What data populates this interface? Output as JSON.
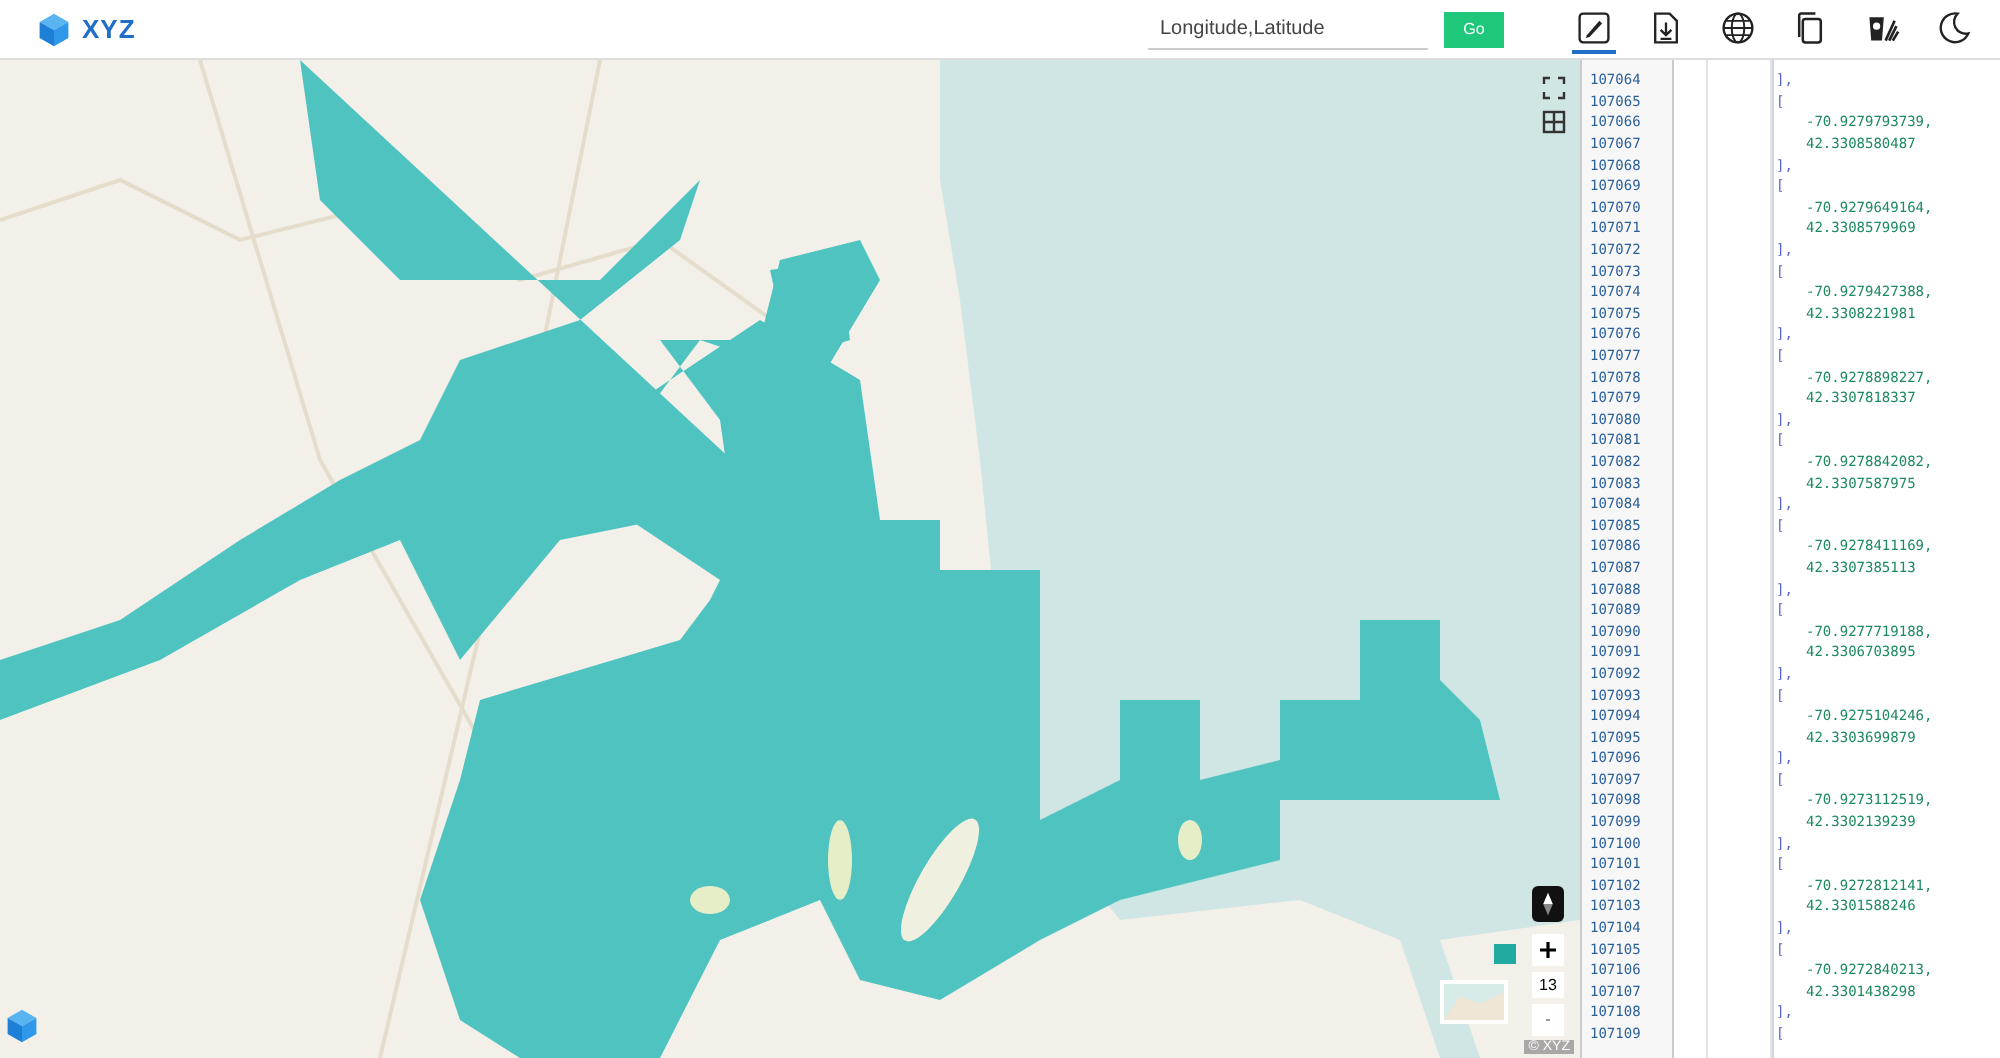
{
  "header": {
    "logo": "XYZ",
    "search": {
      "placeholder": "Longitude,Latitude"
    },
    "go_button": "Go",
    "toolbar": [
      {
        "kind": "edit",
        "selected": true
      },
      {
        "kind": "download",
        "selected": false
      },
      {
        "kind": "globe",
        "selected": false
      },
      {
        "kind": "copy",
        "selected": false
      },
      {
        "kind": "clean",
        "selected": false
      },
      {
        "kind": "theme",
        "selected": false
      }
    ]
  },
  "map": {
    "zoom_level": "13",
    "attribution": "© XYZ"
  },
  "code": {
    "lines": [
      {
        "num": "107064",
        "text": "],",
        "kind": "bracket"
      },
      {
        "num": "107065",
        "text": "[",
        "kind": "bracket"
      },
      {
        "num": "107066",
        "text": "-70.9279793739,",
        "kind": "number"
      },
      {
        "num": "107067",
        "text": "42.3308580487",
        "kind": "number"
      },
      {
        "num": "107068",
        "text": "],",
        "kind": "bracket"
      },
      {
        "num": "107069",
        "text": "[",
        "kind": "bracket"
      },
      {
        "num": "107070",
        "text": "-70.9279649164,",
        "kind": "number"
      },
      {
        "num": "107071",
        "text": "42.3308579969",
        "kind": "number"
      },
      {
        "num": "107072",
        "text": "],",
        "kind": "bracket"
      },
      {
        "num": "107073",
        "text": "[",
        "kind": "bracket"
      },
      {
        "num": "107074",
        "text": "-70.9279427388,",
        "kind": "number"
      },
      {
        "num": "107075",
        "text": "42.3308221981",
        "kind": "number"
      },
      {
        "num": "107076",
        "text": "],",
        "kind": "bracket"
      },
      {
        "num": "107077",
        "text": "[",
        "kind": "bracket"
      },
      {
        "num": "107078",
        "text": "-70.9278898227,",
        "kind": "number"
      },
      {
        "num": "107079",
        "text": "42.3307818337",
        "kind": "number"
      },
      {
        "num": "107080",
        "text": "],",
        "kind": "bracket"
      },
      {
        "num": "107081",
        "text": "[",
        "kind": "bracket"
      },
      {
        "num": "107082",
        "text": "-70.9278842082,",
        "kind": "number"
      },
      {
        "num": "107083",
        "text": "42.3307587975",
        "kind": "number"
      },
      {
        "num": "107084",
        "text": "],",
        "kind": "bracket"
      },
      {
        "num": "107085",
        "text": "[",
        "kind": "bracket"
      },
      {
        "num": "107086",
        "text": "-70.9278411169,",
        "kind": "number"
      },
      {
        "num": "107087",
        "text": "42.3307385113",
        "kind": "number"
      },
      {
        "num": "107088",
        "text": "],",
        "kind": "bracket"
      },
      {
        "num": "107089",
        "text": "[",
        "kind": "bracket"
      },
      {
        "num": "107090",
        "text": "-70.9277719188,",
        "kind": "number"
      },
      {
        "num": "107091",
        "text": "42.3306703895",
        "kind": "number"
      },
      {
        "num": "107092",
        "text": "],",
        "kind": "bracket"
      },
      {
        "num": "107093",
        "text": "[",
        "kind": "bracket"
      },
      {
        "num": "107094",
        "text": "-70.9275104246,",
        "kind": "number"
      },
      {
        "num": "107095",
        "text": "42.3303699879",
        "kind": "number"
      },
      {
        "num": "107096",
        "text": "],",
        "kind": "bracket"
      },
      {
        "num": "107097",
        "text": "[",
        "kind": "bracket"
      },
      {
        "num": "107098",
        "text": "-70.9273112519,",
        "kind": "number"
      },
      {
        "num": "107099",
        "text": "42.3302139239",
        "kind": "number"
      },
      {
        "num": "107100",
        "text": "],",
        "kind": "bracket"
      },
      {
        "num": "107101",
        "text": "[",
        "kind": "bracket"
      },
      {
        "num": "107102",
        "text": "-70.9272812141,",
        "kind": "number"
      },
      {
        "num": "107103",
        "text": "42.3301588246",
        "kind": "number"
      },
      {
        "num": "107104",
        "text": "],",
        "kind": "bracket"
      },
      {
        "num": "107105",
        "text": "[",
        "kind": "bracket"
      },
      {
        "num": "107106",
        "text": "-70.9272840213,",
        "kind": "number"
      },
      {
        "num": "107107",
        "text": "42.3301438298",
        "kind": "number"
      },
      {
        "num": "107108",
        "text": "],",
        "kind": "bracket"
      },
      {
        "num": "107109",
        "text": "[",
        "kind": "bracket"
      }
    ]
  }
}
